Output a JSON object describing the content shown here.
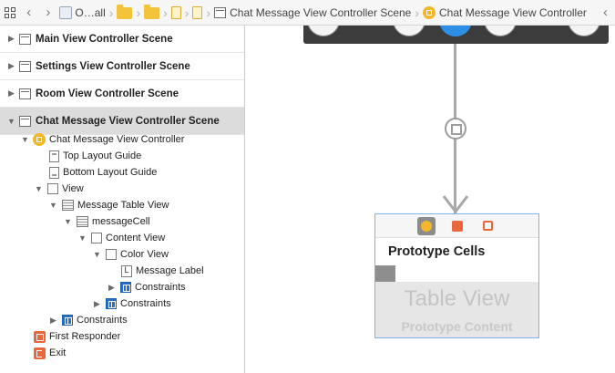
{
  "jumpbar": {
    "crumbs": [
      "O…all",
      "Chat Message View Controller Scene",
      "Chat Message View Controller"
    ]
  },
  "outline": {
    "scenes": [
      {
        "label": "Main View Controller Scene"
      },
      {
        "label": "Settings View Controller Scene"
      },
      {
        "label": "Room View Controller Scene"
      },
      {
        "label": "Chat Message View Controller Scene"
      }
    ],
    "tree": {
      "vc": "Chat Message View Controller",
      "top_guide": "Top Layout Guide",
      "bottom_guide": "Bottom Layout Guide",
      "view": "View",
      "table": "Message Table View",
      "cell": "messageCell",
      "content": "Content View",
      "color": "Color View",
      "label_glyph": "L",
      "label": "Message Label",
      "constraints_1": "Constraints",
      "constraints_2": "Constraints",
      "constraints_3": "Constraints",
      "responder": "First Responder",
      "exit": "Exit"
    }
  },
  "canvas": {
    "prototype_cells": "Prototype Cells",
    "table_view": "Table View",
    "prototype_content": "Prototype Content"
  },
  "colors": {
    "accent": "#2d8ee6",
    "vc_icon": "#f2b72a",
    "object_icon": "#e8673c",
    "constraint_icon": "#2b6fc0",
    "selection_bg": "#dcdcdc"
  }
}
